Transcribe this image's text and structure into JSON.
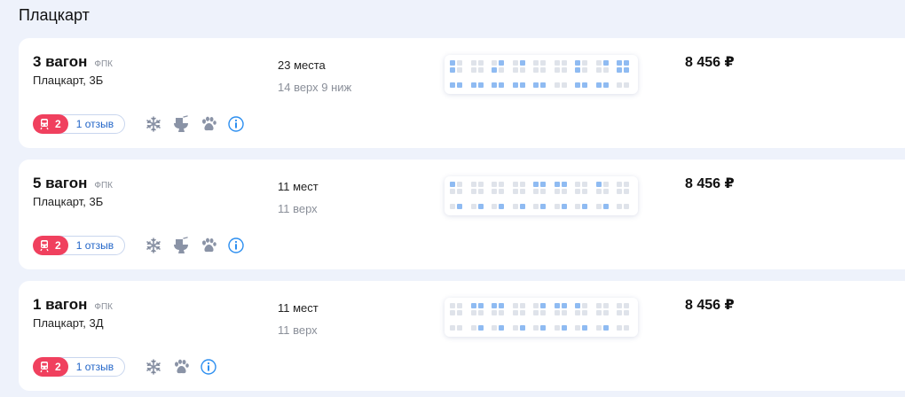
{
  "section": {
    "title": "Плацкарт"
  },
  "colors": {
    "accent": "#f0405e",
    "link": "#2366c8",
    "seat_free": "#8fbbf2",
    "seat_taken": "#dfe3ea",
    "info": "#2d8ff0"
  },
  "cards": [
    {
      "wagon": "3 вагон",
      "carrier": "ФПК",
      "type": "Плацкарт, 3Б",
      "seats_count": "23 места",
      "seats_detail": "14 верх 9 ниж",
      "price": "8 456 ₽",
      "rating": "2",
      "reviews": "1 отзыв",
      "features": [
        "snowflake-icon",
        "toilet-icon",
        "paw-icon",
        "info-icon"
      ],
      "scheme_upper": [
        [
          1,
          0,
          1,
          0
        ],
        [
          0,
          0,
          0,
          0
        ],
        [
          0,
          1,
          1,
          0
        ],
        [
          0,
          1,
          0,
          0
        ],
        [
          0,
          0,
          0,
          0
        ],
        [
          0,
          0,
          0,
          0
        ],
        [
          1,
          0,
          1,
          0
        ],
        [
          0,
          1,
          0,
          0
        ],
        [
          1,
          1,
          1,
          1
        ]
      ],
      "scheme_lower": [
        [
          1,
          1
        ],
        [
          1,
          1
        ],
        [
          1,
          1
        ],
        [
          1,
          1
        ],
        [
          1,
          1
        ],
        [
          0,
          0
        ],
        [
          1,
          1
        ],
        [
          1,
          1
        ],
        [
          0,
          0
        ]
      ]
    },
    {
      "wagon": "5 вагон",
      "carrier": "ФПК",
      "type": "Плацкарт, 3Б",
      "seats_count": "11 мест",
      "seats_detail": "11 верх",
      "price": "8 456 ₽",
      "rating": "2",
      "reviews": "1 отзыв",
      "features": [
        "snowflake-icon",
        "toilet-icon",
        "paw-icon",
        "info-icon"
      ],
      "scheme_upper": [
        [
          1,
          0,
          0,
          0
        ],
        [
          0,
          0,
          0,
          0
        ],
        [
          0,
          0,
          0,
          0
        ],
        [
          0,
          0,
          0,
          0
        ],
        [
          1,
          1,
          0,
          0
        ],
        [
          1,
          1,
          0,
          0
        ],
        [
          0,
          0,
          0,
          0
        ],
        [
          1,
          0,
          0,
          0
        ],
        [
          0,
          0,
          0,
          0
        ]
      ],
      "scheme_lower": [
        [
          0,
          1
        ],
        [
          0,
          1
        ],
        [
          0,
          1
        ],
        [
          0,
          1
        ],
        [
          0,
          1
        ],
        [
          0,
          1
        ],
        [
          0,
          1
        ],
        [
          0,
          1
        ],
        [
          0,
          0
        ]
      ]
    },
    {
      "wagon": "1 вагон",
      "carrier": "ФПК",
      "type": "Плацкарт, 3Д",
      "seats_count": "11 мест",
      "seats_detail": "11 верх",
      "price": "8 456 ₽",
      "rating": "2",
      "reviews": "1 отзыв",
      "features": [
        "snowflake-icon",
        "paw-icon",
        "info-icon"
      ],
      "scheme_upper": [
        [
          0,
          0,
          0,
          0
        ],
        [
          1,
          1,
          0,
          0
        ],
        [
          1,
          1,
          0,
          0
        ],
        [
          0,
          0,
          0,
          0
        ],
        [
          0,
          1,
          0,
          0
        ],
        [
          1,
          1,
          0,
          0
        ],
        [
          1,
          0,
          0,
          0
        ],
        [
          0,
          0,
          0,
          0
        ],
        [
          0,
          0,
          0,
          0
        ]
      ],
      "scheme_lower": [
        [
          0,
          0
        ],
        [
          0,
          1
        ],
        [
          0,
          1
        ],
        [
          0,
          1
        ],
        [
          0,
          1
        ],
        [
          0,
          1
        ],
        [
          0,
          1
        ],
        [
          0,
          1
        ],
        [
          0,
          0
        ]
      ]
    }
  ]
}
